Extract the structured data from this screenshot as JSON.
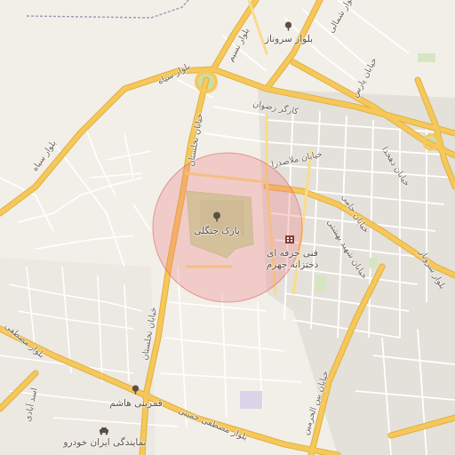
{
  "map": {
    "highlight_color": "#f08080",
    "road_major_color": "#f6c85a",
    "road_minor_color": "#ffffff",
    "park_color": "#c8dfa8",
    "water_color": "#aad3df",
    "background_color": "#f2efe9"
  },
  "pois": {
    "forest_park": {
      "label": "پارک جنگلی",
      "icon": "tree-icon"
    },
    "technical_school": {
      "line1": "فنی حرفه ای",
      "line2": "دختزانه جهرم",
      "icon": "school-icon"
    },
    "sarvnaz_blvd_poi": {
      "label": "بلوار سروناز",
      "icon": "tree-icon"
    },
    "ghamarbani_hashem": {
      "label": "قمربنی هاشم",
      "icon": "tree-icon"
    },
    "iran_khodro_agency": {
      "label": "نمایندگی ایران خودرو",
      "icon": "car-icon"
    }
  },
  "roads": {
    "north_blvd": "بلوار شمالی",
    "nasim_blvd": "بلوار نسیم",
    "siah_blvd": "بلوار سیاه",
    "karegar_rezvan": "کارگر رضوان",
    "pars_st": "خیابان پارس",
    "nakhlestan_st_top": "خیابان نخلستان",
    "nakhlestan_st_bottom": "خیابان نخلستان",
    "mollasadra_st": "خیابان ملاصدرا",
    "dehkhoda_st": "خیابان دهخدا",
    "jami_st": "خیابان جامی",
    "shahid_beheshti_st": "خیابان شهید بهشتی",
    "beinol_haramain_st": "خیابان بین الحرمین",
    "mostafa_khomeini_blvd_left": "بلوار مصطفی",
    "mostafa_khomeini_blvd": "بلوار مصطفی خمینی",
    "asad_abadi": "اسد آبادی",
    "sarvnaz_blvd": "بلوار سروناز"
  }
}
